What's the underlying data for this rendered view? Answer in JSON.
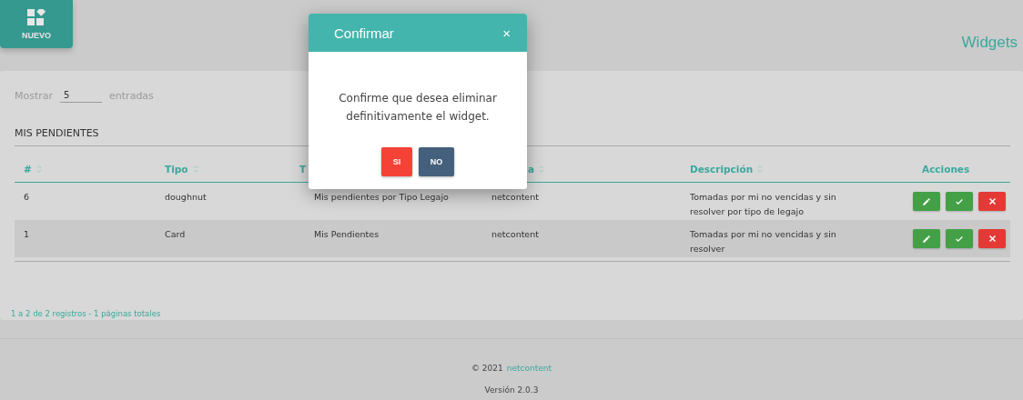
{
  "new_button": {
    "label": "NUEVO"
  },
  "page_title": "Widgets",
  "length_control": {
    "label_before": "Mostrar",
    "value": "5",
    "label_after": "entradas"
  },
  "section_title": "MIS PENDIENTES",
  "table": {
    "columns": [
      {
        "label": "#",
        "sortable": true
      },
      {
        "label": "Tipo",
        "sortable": true
      },
      {
        "label": "T"
      },
      {
        "label": "a",
        "sortable": true
      },
      {
        "label": "Descripción",
        "sortable": true
      },
      {
        "label": "Acciones",
        "sortable": false
      }
    ],
    "rows": [
      {
        "cells": [
          "6",
          "doughnut",
          "Mis pendientes por Tipo Legajo",
          "netcontent",
          "Tomadas por mi no vencidas y sin resolver por tipo de legajo"
        ],
        "shaded": false
      },
      {
        "cells": [
          "1",
          "Card",
          "Mis Pendientes",
          "netcontent",
          "Tomadas por mi no vencidas y sin resolver"
        ],
        "shaded": true
      }
    ]
  },
  "pagination_info": "1 a 2 de 2 registros - 1 páginas totales",
  "footer": {
    "copyright": "© 2021",
    "link": "netcontent",
    "version": "Versión 2.0.3"
  },
  "dialog": {
    "title": "Confirmar",
    "close": "×",
    "message": "Confirme que desea eliminar definitivamente el widget.",
    "buttons": [
      {
        "label": "SI",
        "kind": "danger"
      },
      {
        "label": "NO",
        "kind": "secondary"
      }
    ]
  }
}
